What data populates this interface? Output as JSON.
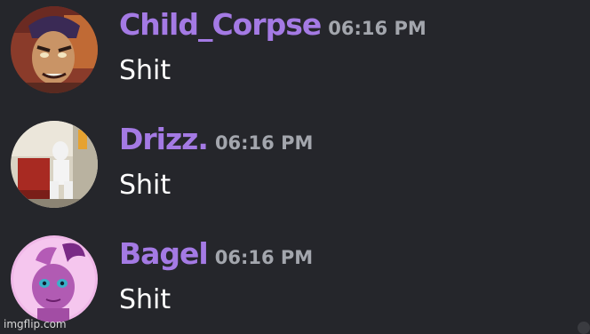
{
  "colors": {
    "background": "#25262b",
    "username": "#a47ae4",
    "timestamp": "#a3a6ad",
    "message_text": "#ffffff"
  },
  "messages": [
    {
      "username": "Child_Corpse",
      "timestamp": "06:16 PM",
      "text": "Shit",
      "avatar": "cartoon-villain-avatar"
    },
    {
      "username": "Drizz.",
      "timestamp": "06:16 PM",
      "text": "Shit",
      "avatar": "stormtrooper-photo-avatar"
    },
    {
      "username": "Bagel",
      "timestamp": "06:16 PM",
      "text": "Shit",
      "avatar": "pink-pony-avatar"
    }
  ],
  "watermark": "imgflip.com"
}
